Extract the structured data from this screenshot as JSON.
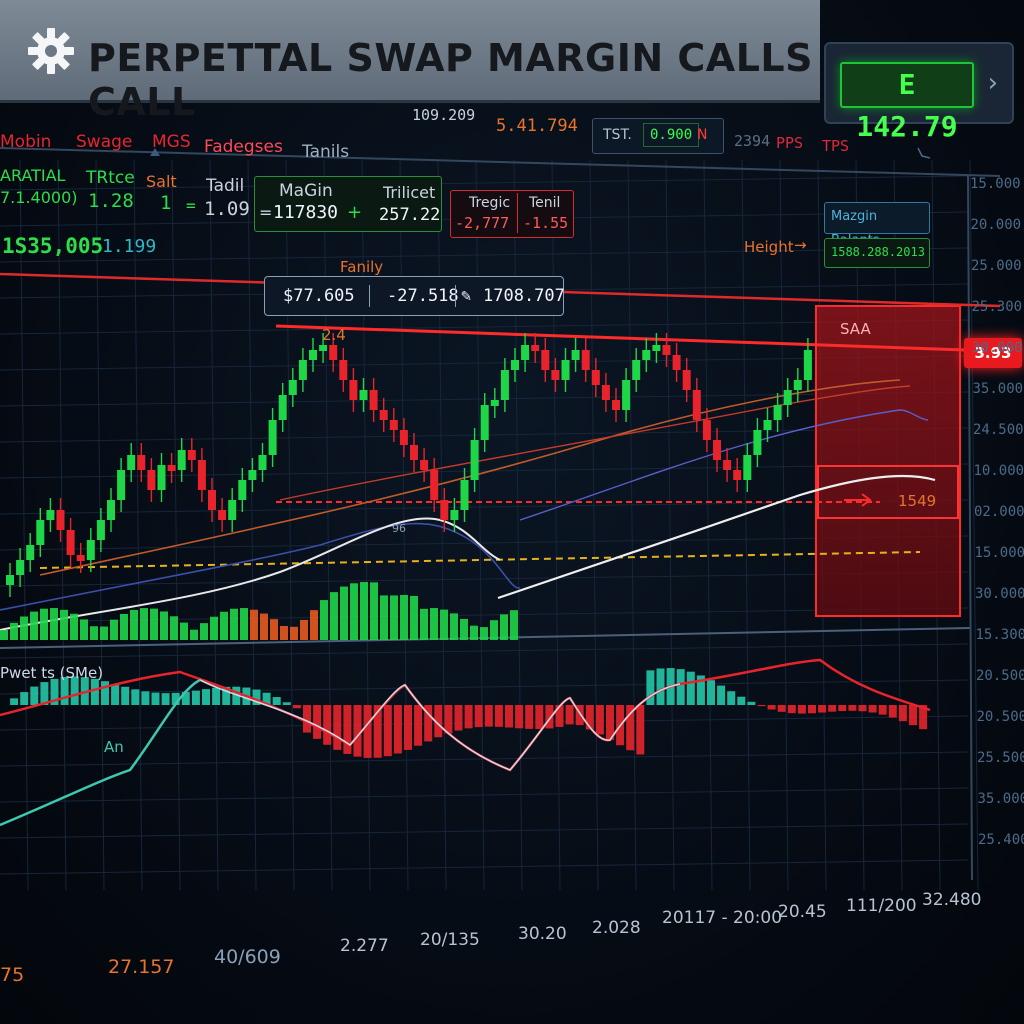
{
  "header": {
    "title": "PERPETTAL SWAP MARGIN CALLS CALL",
    "price_box": "E 142.79"
  },
  "top_readouts": {
    "r1": "109.209",
    "r2": "5.41.794",
    "tst_label": "TST.",
    "tst_value": "0.900",
    "tst_code": "N",
    "r3": "2394",
    "r4": "PPS",
    "r5": "TPS"
  },
  "tabs": [
    "Mobin",
    "Swage",
    "MGS",
    "Fadegses",
    "Tanils"
  ],
  "stats": {
    "partial_label": "ARATIAL",
    "partial_value": "7.1.4000)",
    "trice_label": "TRtce",
    "trice_value": "1.28",
    "salt_label": "Salt",
    "salt_value": "1",
    "tadil_label": "Tadil",
    "tadil_value": "1.09",
    "margin_label": "MaGin",
    "margin_value": "117830",
    "trilicet_label": "Trilicet",
    "trilicet_value": "257.22",
    "equals_sign": "=",
    "equals_sign2": "=",
    "plus_sign": "+"
  },
  "alert_box": {
    "label1": "Tregic",
    "label2": "Tenil",
    "value1": "-2,777",
    "value2": "-1.55"
  },
  "balance": {
    "value": "1S35,005",
    "sub": "1.199"
  },
  "right_panel": {
    "margin_button": "Mazgin Balants",
    "height_label": "Height",
    "height_value": "1588.288.2013",
    "price_tag": "3.93"
  },
  "chart_labels": {
    "family": "Fanily",
    "marker": "2.4",
    "liq_label": "SAA",
    "arrow_label": "1549",
    "small_tag": "96",
    "indicator": "Pwet ts (SMe)",
    "an_label": "An"
  },
  "tooltip": {
    "price": "$77.605",
    "change": "-27.518",
    "volume": "1708.707"
  },
  "y_axis": [
    "15.000",
    "20.000",
    "25.000",
    "25.300",
    "30.000",
    "35.000",
    "24.500",
    "10.000",
    "02.000",
    "15.000",
    "30.000",
    "15.300",
    "20.500",
    "20.500",
    "25.500",
    "35.000",
    "25.400"
  ],
  "x_axis": [
    "2.277",
    "20/135",
    "30.20",
    "2.028",
    "20117 - 20:00",
    "20.45",
    "111/200",
    "32.480"
  ],
  "bottom_left": {
    "v1": "75",
    "v2": "27.157",
    "v3": "40/609"
  },
  "colors": {
    "bull": "#1fd648",
    "bear": "#e8232b",
    "accent_red": "#ff2a2a",
    "grid": "#1b2a3c"
  }
}
